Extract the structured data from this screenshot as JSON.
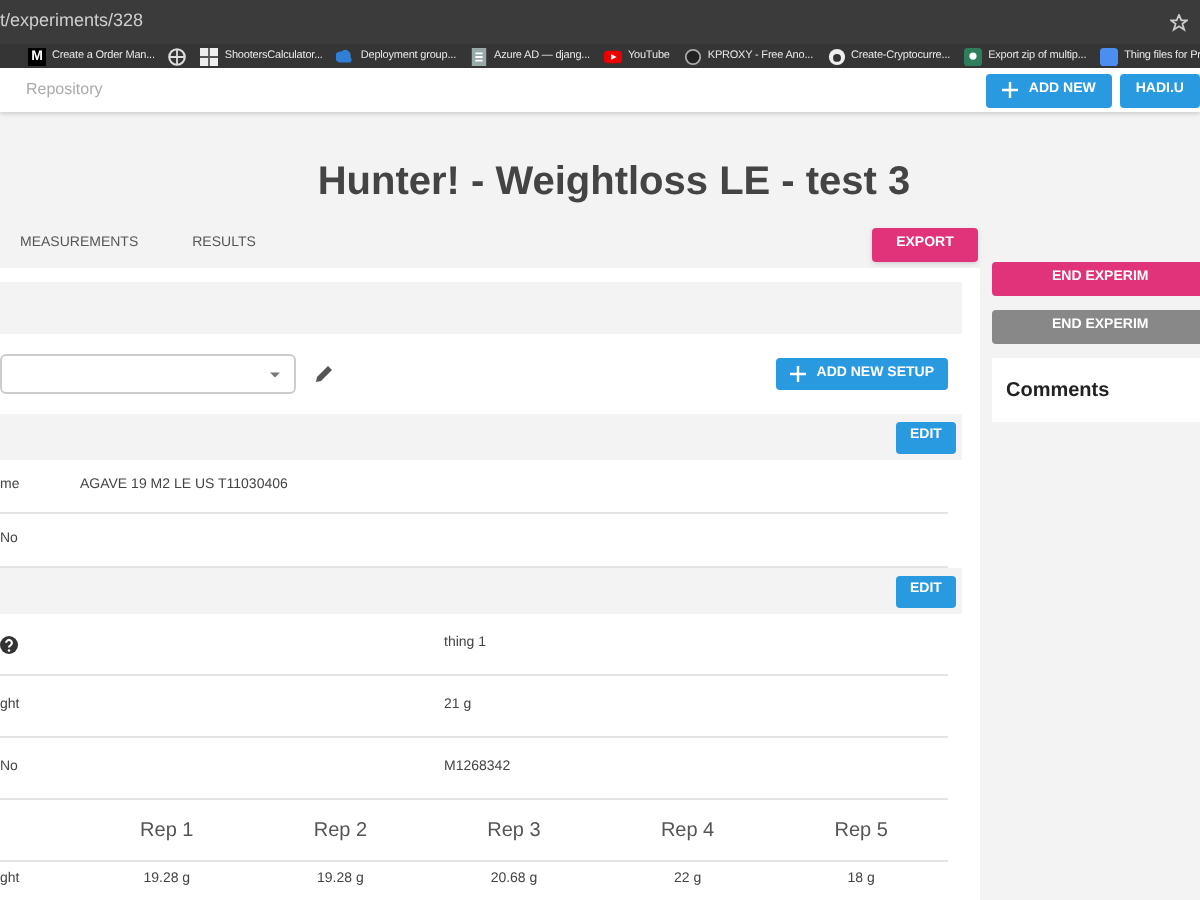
{
  "browser": {
    "address": "t/experiments/328",
    "bookmarks": [
      {
        "label": "Create a Order Man...",
        "glyph": "M"
      },
      {
        "label": "ShootersCalculator..."
      },
      {
        "label": "Deployment group..."
      },
      {
        "label": "Azure AD — djang..."
      },
      {
        "label": "YouTube"
      },
      {
        "label": "KPROXY - Free Ano..."
      },
      {
        "label": "Create-Cryptocurre..."
      },
      {
        "label": "Export zip of multip..."
      },
      {
        "label": "Thing files for Pr"
      }
    ]
  },
  "header": {
    "nav": "Repository",
    "buttons": [
      {
        "label": "ADD NEW",
        "plus": true
      },
      {
        "label": "HADI.U",
        "plus": false
      }
    ]
  },
  "title": "Hunter! - Weightloss LE - test 3",
  "tabs": [
    {
      "label": "MEASUREMENTS",
      "selected": false
    },
    {
      "label": "RESULTS",
      "selected": false
    }
  ],
  "export_button": "EXPORT",
  "add_setup_button": "ADD NEW SETUP",
  "sections": [
    {
      "edit": "EDIT",
      "rows": [
        {
          "label": "me",
          "value": "AGAVE 19 M2 LE US T11030406",
          "help": false
        },
        {
          "label": "No",
          "value": "",
          "help": false
        }
      ]
    },
    {
      "edit": "EDIT",
      "rows": [
        {
          "label": "",
          "value": "thing 1",
          "help": true
        },
        {
          "label": "ght",
          "value": "21 g",
          "help": false
        },
        {
          "label": "No",
          "value": "M1268342",
          "help": false
        }
      ]
    }
  ],
  "reps": {
    "columns": [
      "Rep 1",
      "Rep 2",
      "Rep 3",
      "Rep 4",
      "Rep 5"
    ],
    "rows": [
      {
        "label": "ght",
        "values": [
          "19.28 g",
          "19.28 g",
          "20.68 g",
          "22 g",
          "18 g"
        ]
      }
    ]
  },
  "side": {
    "buttons": [
      {
        "label": "END EXPERIM",
        "kind": "primary"
      },
      {
        "label": "END EXPERIM",
        "kind": "secondary"
      }
    ],
    "comments": "Comments"
  }
}
